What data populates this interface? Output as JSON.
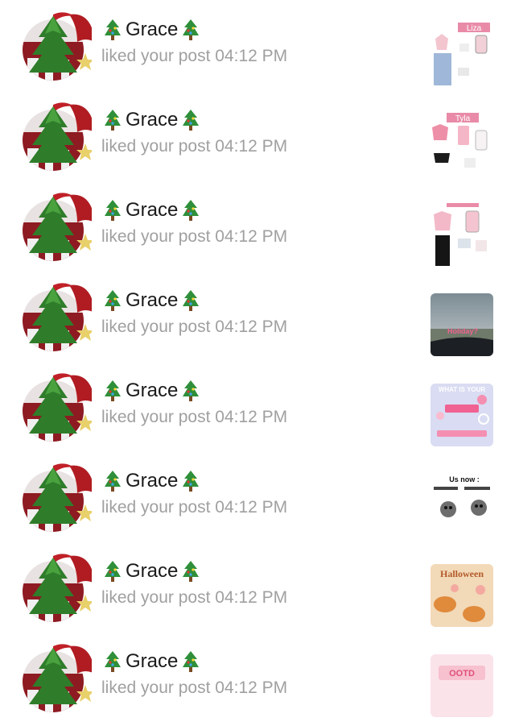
{
  "notifications": [
    {
      "name": "Grace",
      "action": "liked your post",
      "time": "04:12 PM",
      "thumb": "outfit-1",
      "thumb_text": "Liza"
    },
    {
      "name": "Grace",
      "action": "liked your post",
      "time": "04:12 PM",
      "thumb": "outfit-2",
      "thumb_text": "Tyla"
    },
    {
      "name": "Grace",
      "action": "liked your post",
      "time": "04:12 PM",
      "thumb": "outfit-3",
      "thumb_text": ""
    },
    {
      "name": "Grace",
      "action": "liked your post",
      "time": "04:12 PM",
      "thumb": "holiday-photo",
      "thumb_text": "Holiday?"
    },
    {
      "name": "Grace",
      "action": "liked your post",
      "time": "04:12 PM",
      "thumb": "place-graphic",
      "thumb_text": "WHAT IS YOUR"
    },
    {
      "name": "Grace",
      "action": "liked your post",
      "time": "04:12 PM",
      "thumb": "meme-graphic",
      "thumb_text": "Us now :"
    },
    {
      "name": "Grace",
      "action": "liked your post",
      "time": "04:12 PM",
      "thumb": "halloween-graphic",
      "thumb_text": "Halloween"
    },
    {
      "name": "Grace",
      "action": "liked your post",
      "time": "04:12 PM",
      "thumb": "ootd-graphic",
      "thumb_text": "OOTD"
    }
  ],
  "icons": {
    "name_decoration": "christmas-tree-icon"
  },
  "colors": {
    "name": "#1a1a1a",
    "subtext": "#a0a0a0",
    "avatar_hat": "#b01c22",
    "avatar_tree": "#2f7d2a"
  }
}
